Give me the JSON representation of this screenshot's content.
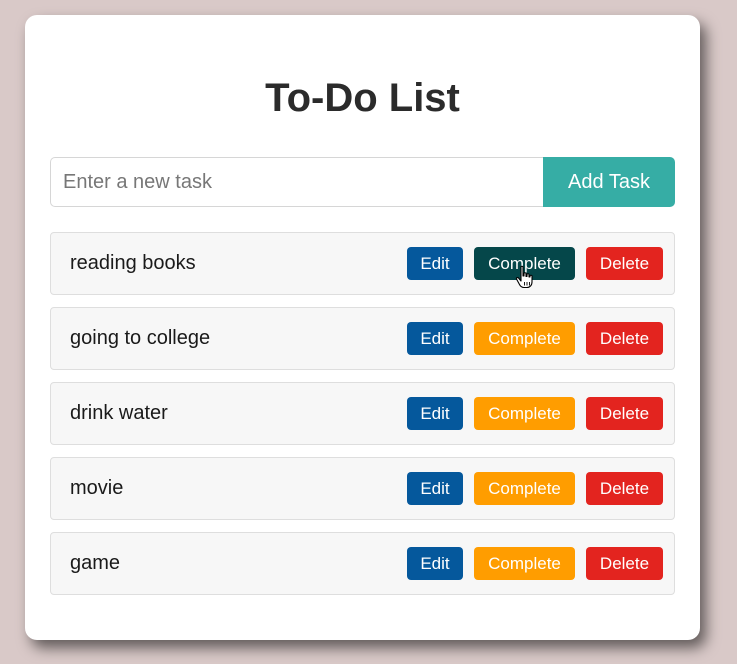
{
  "app": {
    "title": "To-Do List"
  },
  "input": {
    "placeholder": "Enter a new task",
    "value": ""
  },
  "add_button": {
    "label": "Add Task"
  },
  "tasks": [
    {
      "text": "reading books",
      "edit_label": "Edit",
      "complete_label": "Complete",
      "delete_label": "Delete"
    },
    {
      "text": "going to college",
      "edit_label": "Edit",
      "complete_label": "Complete",
      "delete_label": "Delete"
    },
    {
      "text": "drink water",
      "edit_label": "Edit",
      "complete_label": "Complete",
      "delete_label": "Delete"
    },
    {
      "text": "movie",
      "edit_label": "Edit",
      "complete_label": "Complete",
      "delete_label": "Delete"
    },
    {
      "text": "game",
      "edit_label": "Edit",
      "complete_label": "Complete",
      "delete_label": "Delete"
    }
  ],
  "colors": {
    "background": "#d9c9c8",
    "accent": "#36ada5",
    "edit": "#05589c",
    "complete": "#ff9d00",
    "complete_hover": "#05474a",
    "delete": "#e3241f"
  },
  "hovered_button": "tasks.0.complete",
  "cursor_icon": "hand-pointer-icon"
}
